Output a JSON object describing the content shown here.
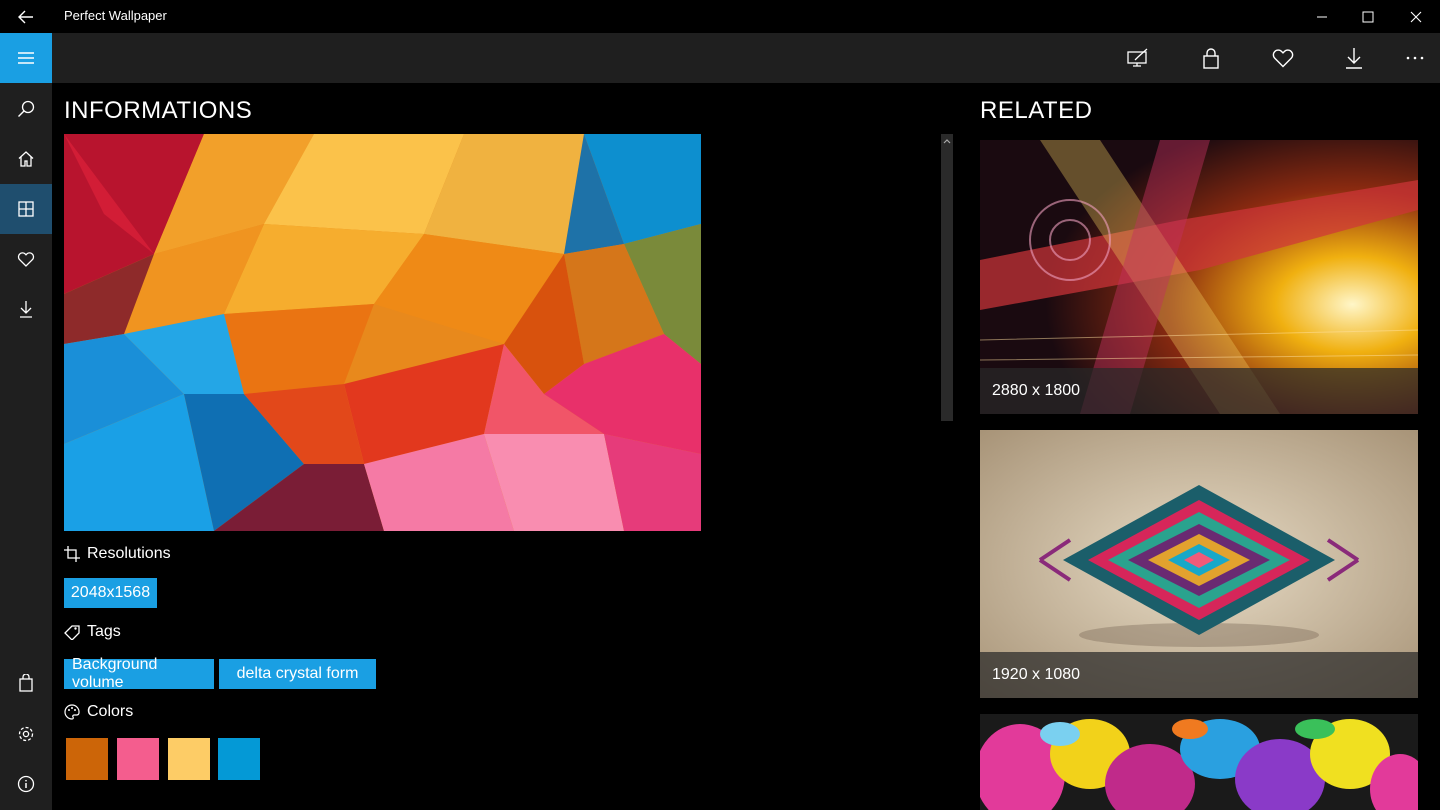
{
  "window": {
    "title": "Perfect Wallpaper",
    "back_icon": "back-arrow-icon",
    "minimize_icon": "minimize-icon",
    "maximize_icon": "maximize-icon",
    "close_icon": "close-icon"
  },
  "sidebar": {
    "items": [
      {
        "name": "hamburger",
        "icon": "hamburger-icon"
      },
      {
        "name": "search",
        "icon": "search-icon"
      },
      {
        "name": "home",
        "icon": "home-icon"
      },
      {
        "name": "categories",
        "icon": "grid-icon",
        "active": true
      },
      {
        "name": "favorites",
        "icon": "heart-icon"
      },
      {
        "name": "downloads",
        "icon": "download-icon"
      },
      {
        "name": "store",
        "icon": "shopping-bag-icon"
      },
      {
        "name": "settings",
        "icon": "gear-icon"
      },
      {
        "name": "about",
        "icon": "info-icon"
      }
    ]
  },
  "commandbar": {
    "buttons": [
      "set-desktop-icon",
      "lock-screen-icon",
      "heart-icon",
      "download-icon",
      "more-icon"
    ]
  },
  "main": {
    "title": "INFORMATIONS",
    "resolutions_label": "Resolutions",
    "resolution_chip": "2048x1568",
    "tags_label": "Tags",
    "tags": [
      "Background volume",
      "delta crystal form"
    ],
    "colors_label": "Colors",
    "colors": [
      "#cc6508",
      "#f45d8e",
      "#fdcc66",
      "#0499d6"
    ]
  },
  "related": {
    "title": "RELATED",
    "items": [
      {
        "caption": "2880 x 1800"
      },
      {
        "caption": "1920 x 1080"
      }
    ]
  },
  "theme": {
    "accent": "#1a9fe3",
    "background": "#000000",
    "panel": "#1f1f1f"
  }
}
